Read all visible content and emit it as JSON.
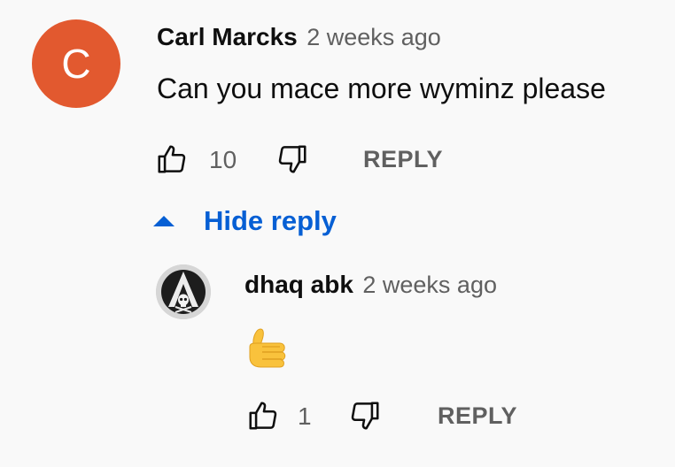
{
  "comment": {
    "avatar_letter": "C",
    "avatar_color": "#e2592f",
    "author": "Carl Marcks",
    "timestamp": "2 weeks ago",
    "text": "Can you mace more wyminz please",
    "likes": "10",
    "reply_label": "REPLY"
  },
  "toggle": {
    "label": "Hide reply",
    "icon": "triangle-up-icon",
    "color": "#065fd4"
  },
  "reply": {
    "avatar_icon": "assassin-skull-emblem-icon",
    "author": "dhaq abk",
    "timestamp": "2 weeks ago",
    "emoji": "thumbs-up-emoji",
    "likes": "1",
    "reply_label": "REPLY"
  },
  "icons": {
    "like": "thumbs-up-icon",
    "dislike": "thumbs-down-icon"
  }
}
